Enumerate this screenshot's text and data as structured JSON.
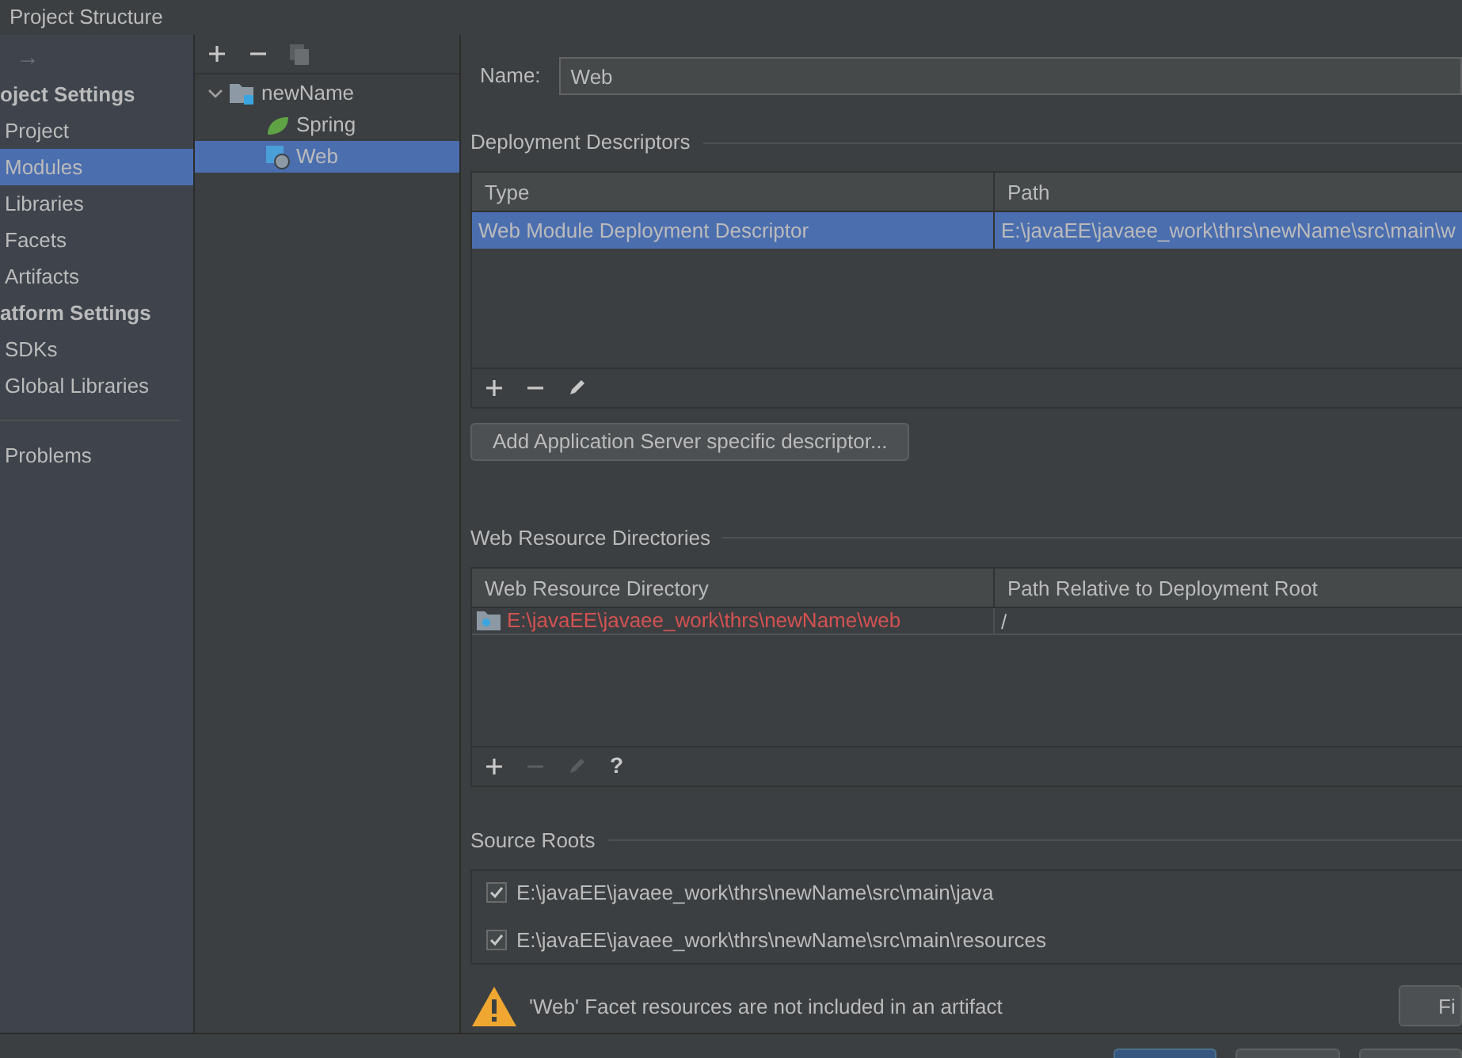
{
  "window": {
    "title": "Project Structure"
  },
  "nav": {
    "forward": "→",
    "groups": [
      {
        "heading": "oject Settings",
        "items": [
          {
            "label": "Project",
            "selected": false
          },
          {
            "label": "Modules",
            "selected": true
          },
          {
            "label": "Libraries",
            "selected": false
          },
          {
            "label": "Facets",
            "selected": false
          },
          {
            "label": "Artifacts",
            "selected": false
          }
        ]
      },
      {
        "heading": "atform Settings",
        "items": [
          {
            "label": "SDKs",
            "selected": false
          },
          {
            "label": "Global Libraries",
            "selected": false
          }
        ]
      }
    ],
    "extra": [
      {
        "label": "Problems",
        "selected": false
      }
    ]
  },
  "tree": {
    "items": [
      {
        "label": "newName",
        "kind": "module",
        "expanded": true,
        "selected": false,
        "children": [
          {
            "label": "Spring",
            "kind": "spring",
            "selected": false
          },
          {
            "label": "Web",
            "kind": "web",
            "selected": true
          }
        ]
      }
    ]
  },
  "name_field": {
    "label": "Name:",
    "value": "Web"
  },
  "deployment_descriptors": {
    "title": "Deployment Descriptors",
    "columns": [
      "Type",
      "Path"
    ],
    "rows": [
      {
        "cells": [
          "Web Module Deployment Descriptor",
          "E:\\javaEE\\javaee_work\\thrs\\newName\\src\\main\\w"
        ],
        "selected": true
      }
    ],
    "add_button": "Add Application Server specific descriptor..."
  },
  "web_resource_directories": {
    "title": "Web Resource Directories",
    "columns": [
      "Web Resource Directory",
      "Path Relative to Deployment Root"
    ],
    "rows": [
      {
        "cells": [
          "E:\\javaEE\\javaee_work\\thrs\\newName\\web",
          "/"
        ],
        "missing": true
      }
    ],
    "help": "?"
  },
  "source_roots": {
    "title": "Source Roots",
    "items": [
      {
        "label": "E:\\javaEE\\javaee_work\\thrs\\newName\\src\\main\\java",
        "checked": true
      },
      {
        "label": "E:\\javaEE\\javaee_work\\thrs\\newName\\src\\main\\resources",
        "checked": true
      }
    ]
  },
  "warning": {
    "message": "'Web' Facet resources are not included in an artifact",
    "fix_button": "Fi"
  },
  "dialog_buttons": [
    {
      "default": true
    },
    {
      "default": false
    },
    {
      "default": false
    }
  ]
}
